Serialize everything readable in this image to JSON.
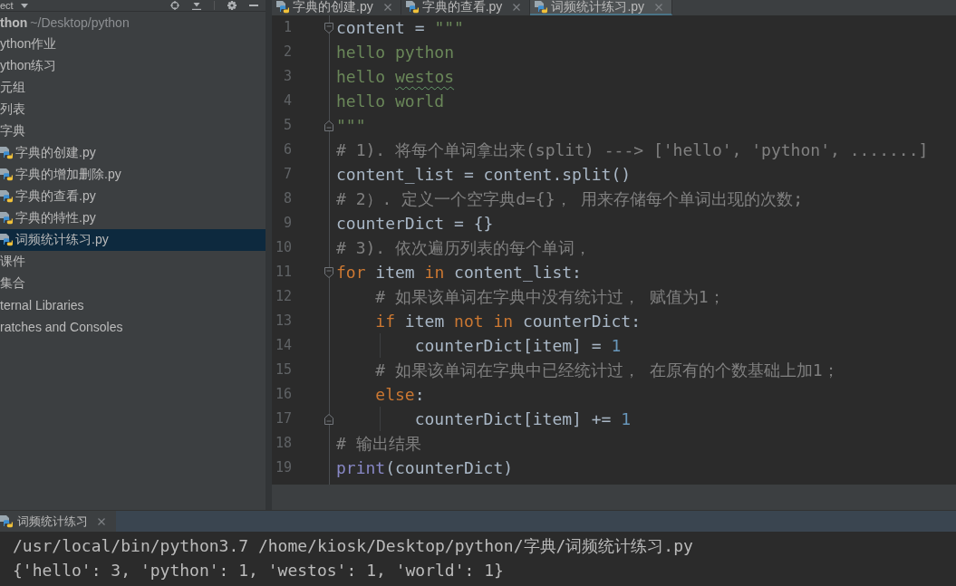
{
  "project_panel": {
    "title": "ect",
    "tree": [
      {
        "kind": "root",
        "name": "thon",
        "path": "~/Desktop/python",
        "selected": false,
        "children": [
          {
            "kind": "folder",
            "name": "ython作业",
            "selected": false
          },
          {
            "kind": "folder",
            "name": "ython练习",
            "selected": false
          },
          {
            "kind": "folder",
            "name": "元组",
            "selected": false
          },
          {
            "kind": "folder",
            "name": "列表",
            "selected": false
          },
          {
            "kind": "folder",
            "name": "字典",
            "selected": false,
            "children": [
              {
                "kind": "file",
                "name": "字典的创建.py",
                "selected": false
              },
              {
                "kind": "file",
                "name": "字典的增加删除.py",
                "selected": false
              },
              {
                "kind": "file",
                "name": "字典的查看.py",
                "selected": false
              },
              {
                "kind": "file",
                "name": "字典的特性.py",
                "selected": false
              },
              {
                "kind": "file",
                "name": "词频统计练习.py",
                "selected": true
              }
            ]
          },
          {
            "kind": "folder",
            "name": "课件",
            "selected": false
          },
          {
            "kind": "folder",
            "name": "集合",
            "selected": false
          }
        ]
      },
      {
        "kind": "group",
        "name": "ternal Libraries",
        "selected": false
      },
      {
        "kind": "group",
        "name": "ratches and Consoles",
        "selected": false
      }
    ]
  },
  "editor": {
    "tabs": [
      {
        "label": "字典的创建.py",
        "selected": false
      },
      {
        "label": "字典的查看.py",
        "selected": false
      },
      {
        "label": "词频统计练习.py",
        "selected": true
      }
    ],
    "lines": [
      {
        "number": "1",
        "kind": "foldstart",
        "tokens": [
          {
            "kind": "plain",
            "text": "content = "
          },
          {
            "kind": "string",
            "text": "\"\"\""
          }
        ]
      },
      {
        "number": "2",
        "kind": "plain",
        "tokens": [
          {
            "kind": "string",
            "text": "hello python"
          }
        ]
      },
      {
        "number": "3",
        "kind": "plain",
        "tokens": [
          {
            "kind": "string",
            "text": "hello "
          },
          {
            "kind": "misspelled",
            "text": "westos"
          }
        ]
      },
      {
        "number": "4",
        "kind": "plain",
        "tokens": [
          {
            "kind": "string",
            "text": "hello world"
          }
        ]
      },
      {
        "number": "5",
        "kind": "foldend",
        "tokens": [
          {
            "kind": "string",
            "text": "\"\"\""
          }
        ]
      },
      {
        "number": "6",
        "kind": "plain",
        "tokens": [
          {
            "kind": "comment",
            "text": "# 1). 将每个单词拿出来(split) ---> ['hello', 'python', .......]"
          }
        ]
      },
      {
        "number": "7",
        "kind": "plain",
        "tokens": [
          {
            "kind": "plain",
            "text": "content_list = content.split()"
          }
        ]
      },
      {
        "number": "8",
        "kind": "plain",
        "tokens": [
          {
            "kind": "comment",
            "text": "# 2）. 定义一个空字典d={}， 用来存储每个单词出现的次数;"
          }
        ]
      },
      {
        "number": "9",
        "kind": "plain",
        "tokens": [
          {
            "kind": "plain",
            "text": "counterDict = {}"
          }
        ]
      },
      {
        "number": "10",
        "kind": "plain",
        "tokens": [
          {
            "kind": "comment",
            "text": "# 3). 依次遍历列表的每个单词，"
          }
        ]
      },
      {
        "number": "11",
        "kind": "foldstart",
        "tokens": [
          {
            "kind": "keyword",
            "text": "for"
          },
          {
            "kind": "plain",
            "text": " item "
          },
          {
            "kind": "keyword",
            "text": "in"
          },
          {
            "kind": "plain",
            "text": " content_list:"
          }
        ],
        "children": [
          {
            "number": "12",
            "kind": "plain",
            "tokens": [
              {
                "kind": "comment",
                "text": "# 如果该单词在字典中没有统计过， 赋值为1；"
              }
            ]
          },
          {
            "number": "13",
            "kind": "plain",
            "tokens": [
              {
                "kind": "keyword",
                "text": "if"
              },
              {
                "kind": "plain",
                "text": " item "
              },
              {
                "kind": "keyword",
                "text": "not in"
              },
              {
                "kind": "plain",
                "text": " counterDict:"
              }
            ],
            "children": [
              {
                "number": "14",
                "kind": "plain",
                "tokens": [
                  {
                    "kind": "plain",
                    "text": "counterDict[item] = "
                  },
                  {
                    "kind": "number",
                    "text": "1"
                  }
                ]
              }
            ]
          },
          {
            "number": "15",
            "kind": "plain",
            "tokens": [
              {
                "kind": "comment",
                "text": "# 如果该单词在字典中已经统计过， 在原有的个数基础上加1；"
              }
            ]
          },
          {
            "number": "16",
            "kind": "plain",
            "tokens": [
              {
                "kind": "keyword",
                "text": "else"
              },
              {
                "kind": "plain",
                "text": ":"
              }
            ],
            "children": [
              {
                "number": "17",
                "kind": "foldend",
                "tokens": [
                  {
                    "kind": "plain",
                    "text": "counterDict[item] += "
                  },
                  {
                    "kind": "number",
                    "text": "1"
                  }
                ]
              }
            ]
          }
        ]
      },
      {
        "number": "18",
        "kind": "plain",
        "tokens": [
          {
            "kind": "comment",
            "text": "# 输出结果"
          }
        ]
      },
      {
        "number": "19",
        "kind": "plain",
        "tokens": [
          {
            "kind": "builtin",
            "text": "print"
          },
          {
            "kind": "plain",
            "text": "(counterDict)"
          }
        ]
      }
    ]
  },
  "run_panel": {
    "tab": {
      "label": "词频统计练习"
    },
    "output": [
      "/usr/local/bin/python3.7 /home/kiosk/Desktop/python/字典/词频统计练习.py",
      "{'hello': 3, 'python': 1, 'westos': 1, 'world': 1}"
    ]
  }
}
